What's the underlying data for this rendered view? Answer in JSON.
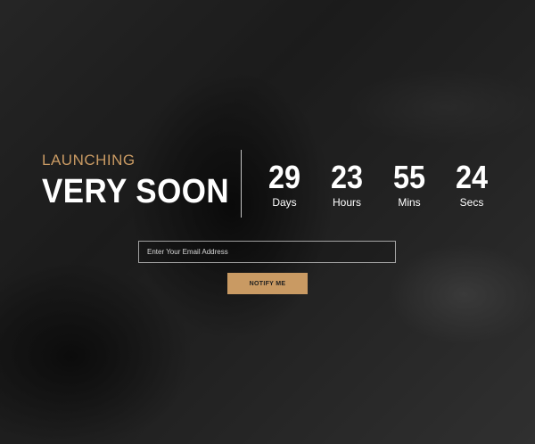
{
  "hero": {
    "launching": "LAUNCHING",
    "headline": "VERY SOON"
  },
  "countdown": [
    {
      "value": "29",
      "label": "Days"
    },
    {
      "value": "23",
      "label": "Hours"
    },
    {
      "value": "55",
      "label": "Mins"
    },
    {
      "value": "24",
      "label": "Secs"
    }
  ],
  "form": {
    "email_placeholder": "Enter Your Email Address",
    "submit_label": "NOTIFY ME"
  },
  "colors": {
    "accent": "#c99a63",
    "text": "#ffffff"
  }
}
